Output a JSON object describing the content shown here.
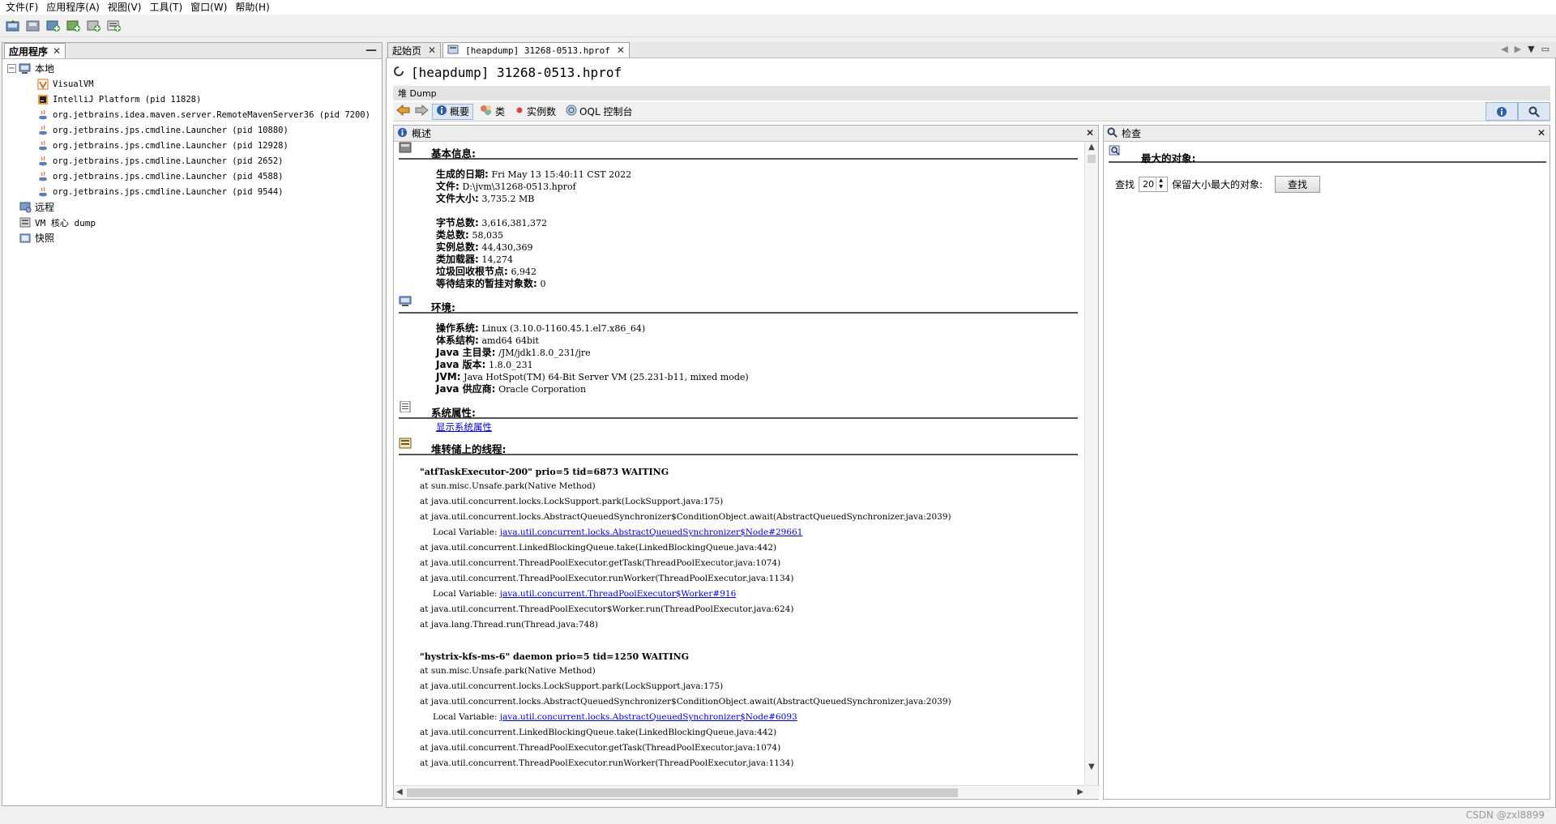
{
  "menu": [
    "文件(F)",
    "应用程序(A)",
    "视图(V)",
    "工具(T)",
    "窗口(W)",
    "帮助(H)"
  ],
  "left_panel": {
    "tab_label": "应用程序",
    "minimize": "—",
    "tree": {
      "local_label": "本地",
      "local_children": [
        "VisualVM",
        "IntelliJ Platform (pid 11828)",
        "org.jetbrains.idea.maven.server.RemoteMavenServer36 (pid 7200)",
        "org.jetbrains.jps.cmdline.Launcher (pid 10880)",
        "org.jetbrains.jps.cmdline.Launcher (pid 12928)",
        "org.jetbrains.jps.cmdline.Launcher (pid 2652)",
        "org.jetbrains.jps.cmdline.Launcher (pid 4588)",
        "org.jetbrains.jps.cmdline.Launcher (pid 9544)"
      ],
      "remote_label": "远程",
      "core_dump_label": "VM 核心 dump",
      "snapshot_label": "快照"
    }
  },
  "doc_tabs": {
    "start_page": "起始页",
    "heapdump_tab": "[heapdump] 31268-0513.hprof"
  },
  "doc": {
    "title": "[heapdump] 31268-0513.hprof",
    "dump_bar": "堆 Dump",
    "views": {
      "summary": "概要",
      "classes": "类",
      "instances": "实例数",
      "oql": "OQL 控制台"
    }
  },
  "summary": {
    "header": "概述",
    "basic_info": {
      "title": "基本信息:",
      "rows": [
        {
          "k": "生成的日期:",
          "v": "Fri May 13 15:40:11 CST 2022"
        },
        {
          "k": "文件:",
          "v": "D:\\jvm\\31268-0513.hprof"
        },
        {
          "k": "文件大小:",
          "v": "3,735.2 MB"
        }
      ],
      "stats": [
        {
          "k": "字节总数:",
          "v": "3,616,381,372"
        },
        {
          "k": "类总数:",
          "v": "58,035"
        },
        {
          "k": "实例总数:",
          "v": "44,430,369"
        },
        {
          "k": "类加载器:",
          "v": "14,274"
        },
        {
          "k": "垃圾回收根节点:",
          "v": "6,942"
        },
        {
          "k": "等待结束的暂挂对象数:",
          "v": "0"
        }
      ]
    },
    "environment": {
      "title": "环境:",
      "rows": [
        {
          "k": "操作系统:",
          "v": "Linux (3.10.0-1160.45.1.el7.x86_64)"
        },
        {
          "k": "体系结构:",
          "v": "amd64 64bit"
        },
        {
          "k": "Java 主目录:",
          "v": "/JM/jdk1.8.0_231/jre"
        },
        {
          "k": "Java 版本:",
          "v": "1.8.0_231"
        },
        {
          "k": "JVM:",
          "v": "Java HotSpot(TM) 64-Bit Server VM (25.231-b11, mixed mode)"
        },
        {
          "k": "Java 供应商:",
          "v": "Oracle Corporation"
        }
      ]
    },
    "system_props": {
      "title": "系统属性:",
      "link": "显示系统属性"
    },
    "threads": {
      "title": "堆转储上的线程:",
      "thread1": {
        "title": "\"atfTaskExecutor-200\" prio=5 tid=6873 WAITING",
        "frames": [
          "at sun.misc.Unsafe.park(Native Method)",
          "at java.util.concurrent.locks.LockSupport.park(LockSupport.java:175)",
          "at java.util.concurrent.locks.AbstractQueuedSynchronizer$ConditionObject.await(AbstractQueuedSynchronizer.java:2039)"
        ],
        "local_var_label": "Local Variable:",
        "local_var_link": "java.util.concurrent.locks.AbstractQueuedSynchronizer$Node#29661",
        "frames2": [
          "at java.util.concurrent.LinkedBlockingQueue.take(LinkedBlockingQueue.java:442)",
          "at java.util.concurrent.ThreadPoolExecutor.getTask(ThreadPoolExecutor.java:1074)",
          "at java.util.concurrent.ThreadPoolExecutor.runWorker(ThreadPoolExecutor.java:1134)"
        ],
        "local_var_link2": "java.util.concurrent.ThreadPoolExecutor$Worker#916",
        "frames3": [
          "at java.util.concurrent.ThreadPoolExecutor$Worker.run(ThreadPoolExecutor.java:624)",
          "at java.lang.Thread.run(Thread.java:748)"
        ]
      },
      "thread2": {
        "title": "\"hystrix-kfs-ms-6\" daemon prio=5 tid=1250 WAITING",
        "frames": [
          "at sun.misc.Unsafe.park(Native Method)",
          "at java.util.concurrent.locks.LockSupport.park(LockSupport.java:175)",
          "at java.util.concurrent.locks.AbstractQueuedSynchronizer$ConditionObject.await(AbstractQueuedSynchronizer.java:2039)"
        ],
        "local_var_label": "Local Variable:",
        "local_var_link": "java.util.concurrent.locks.AbstractQueuedSynchronizer$Node#6093",
        "frames2": [
          "at java.util.concurrent.LinkedBlockingQueue.take(LinkedBlockingQueue.java:442)",
          "at java.util.concurrent.ThreadPoolExecutor.getTask(ThreadPoolExecutor.java:1074)",
          "at java.util.concurrent.ThreadPoolExecutor.runWorker(ThreadPoolExecutor.java:1134)"
        ]
      }
    }
  },
  "inspect": {
    "header": "检查",
    "section_title": "最大的对象:",
    "find_label": "查找",
    "count": "20",
    "suffix_label": "保留大小最大的对象:",
    "find_button": "查找"
  },
  "watermark": "CSDN @zxl8899",
  "colors": {
    "link": "#0000cc",
    "active_view_bg": "#dde7f4"
  }
}
